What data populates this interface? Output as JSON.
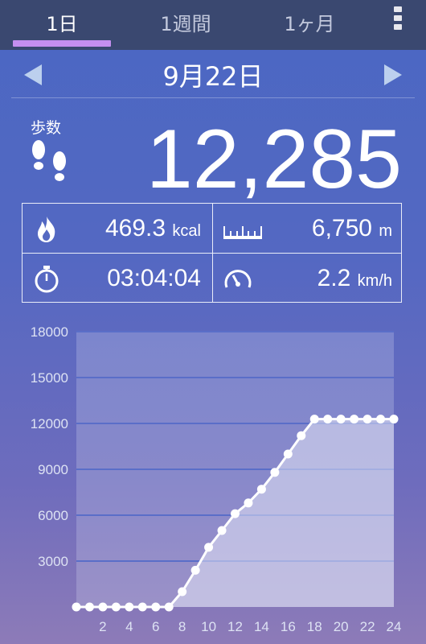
{
  "tabs": [
    {
      "label": "1日",
      "active": true
    },
    {
      "label": "1週間",
      "active": false
    },
    {
      "label": "1ヶ月",
      "active": false
    }
  ],
  "date": "9月22日",
  "steps": {
    "label": "歩数",
    "value": "12,285"
  },
  "stats": {
    "calories": {
      "value": "469.3",
      "unit": "kcal",
      "icon": "flame-icon"
    },
    "distance": {
      "value": "6,750",
      "unit": "m",
      "icon": "ruler-icon"
    },
    "duration": {
      "value": "03:04:04",
      "icon": "stopwatch-icon"
    },
    "speed": {
      "value": "2.2",
      "unit": "km/h",
      "icon": "speedometer-icon"
    }
  },
  "colors": {
    "accent": "#c58ff0",
    "topbar": "#3a4870"
  },
  "chart_data": {
    "type": "area",
    "ylim": [
      0,
      18000
    ],
    "yticks": [
      3000,
      6000,
      9000,
      12000,
      15000,
      18000
    ],
    "xticks": [
      2,
      4,
      6,
      8,
      10,
      12,
      14,
      16,
      18,
      20,
      22,
      24
    ],
    "grid": true,
    "x": [
      0,
      1,
      2,
      3,
      4,
      5,
      6,
      7,
      8,
      9,
      10,
      11,
      12,
      13,
      14,
      15,
      16,
      17,
      18,
      19,
      20,
      21,
      22,
      23,
      24
    ],
    "y": [
      0,
      0,
      0,
      0,
      0,
      0,
      0,
      0,
      1000,
      2400,
      3900,
      5000,
      6100,
      6800,
      7700,
      8800,
      10000,
      11200,
      12285,
      12285,
      12285,
      12285,
      12285,
      12285,
      12285
    ]
  }
}
